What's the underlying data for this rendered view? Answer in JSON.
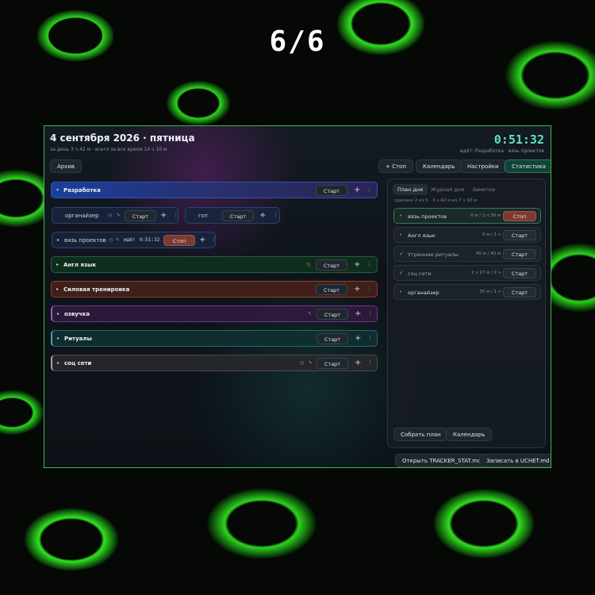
{
  "counter": "6/6",
  "header": {
    "date": "4 сентября 2026 · пятница",
    "subtitle": "за день 3 ч 42 м · всего за все время 14 ч 10 м",
    "timer": "0:51:32",
    "running": "идёт: Разработка · вязь проектов"
  },
  "toolbar": {
    "archive": "Архив",
    "stop": "+ Стоп",
    "calendar": "Календарь",
    "settings": "Настройки",
    "stats": "Статистика"
  },
  "tasks": [
    {
      "name": "Разработка",
      "start": "Старт"
    },
    {
      "name": "органайзер",
      "start": "Старт"
    },
    {
      "name": "гот",
      "start": "Старт"
    },
    {
      "name": "вязь проектов",
      "status": "идёт",
      "elapsed": "0:51:32",
      "stop": "Стоп"
    },
    {
      "name": "Англ язык",
      "start": "Старт"
    },
    {
      "name": "Силовая тренировка",
      "start": "Старт"
    },
    {
      "name": "озвучка",
      "start": "Старт"
    },
    {
      "name": "Ритуалы",
      "start": "Старт"
    },
    {
      "name": "соц сети",
      "start": "Старт"
    }
  ],
  "panel": {
    "tabs": [
      "План дня",
      "Журнал дня",
      "Заметки"
    ],
    "summary": "сделано 2 из 5 · 3 ч 42 м из 7 ч 10 м",
    "items": [
      {
        "name": "вязь проектов",
        "time": "0 м / 2 ч 30 м",
        "button": "Стоп",
        "mark": "•"
      },
      {
        "name": "Англ язык",
        "time": "0 м / 1 ч",
        "button": "Старт",
        "mark": "•"
      },
      {
        "name": "Утренние ритуалы",
        "time": "40 м / 40 м",
        "button": "Старт",
        "mark": "✓"
      },
      {
        "name": "соц сети",
        "time": "2 ч 27 м / 2 ч",
        "button": "Старт",
        "mark": "✓"
      },
      {
        "name": "органайзер",
        "time": "35 м / 1 ч",
        "button": "Старт",
        "mark": "•"
      }
    ],
    "collect": "Собрать план",
    "calendar": "Календарь"
  },
  "footer": {
    "open": "Открыть TRACKER_STAT.md",
    "write": "Записать в UCHET.md"
  },
  "icons": {
    "plus": "+",
    "more": "⋮",
    "expanded": "▾",
    "collapsed": "▸",
    "clock": "◷",
    "pen": "✎"
  },
  "colors": {
    "accent": "#5fe3b4",
    "border": "#3fb84f",
    "stop": "#7a3a33"
  }
}
